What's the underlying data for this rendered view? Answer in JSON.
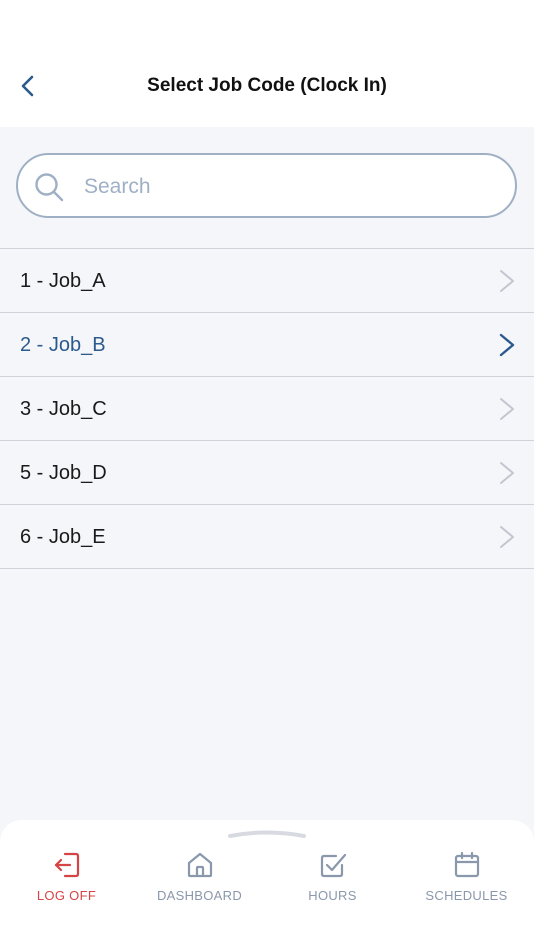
{
  "header": {
    "title": "Select Job Code (Clock In)",
    "back_icon": "chevron-left-icon"
  },
  "search": {
    "placeholder": "Search",
    "value": "",
    "icon": "search-icon"
  },
  "jobs": [
    {
      "label": "1 - Job_A",
      "selected": false
    },
    {
      "label": "2 - Job_B",
      "selected": true
    },
    {
      "label": "3 - Job_C",
      "selected": false
    },
    {
      "label": "5 - Job_D",
      "selected": false
    },
    {
      "label": "6 - Job_E",
      "selected": false
    }
  ],
  "bottom_nav": {
    "tabs": [
      {
        "label": "LOG OFF",
        "icon": "logout-icon"
      },
      {
        "label": "DASHBOARD",
        "icon": "home-icon"
      },
      {
        "label": "HOURS",
        "icon": "checkbox-icon"
      },
      {
        "label": "SCHEDULES",
        "icon": "calendar-icon"
      }
    ]
  },
  "colors": {
    "accent": "#2b5a8c",
    "danger": "#d64545",
    "muted": "#8a98ab",
    "chevron": "#c2c7cf",
    "background": "#f5f6fa"
  }
}
